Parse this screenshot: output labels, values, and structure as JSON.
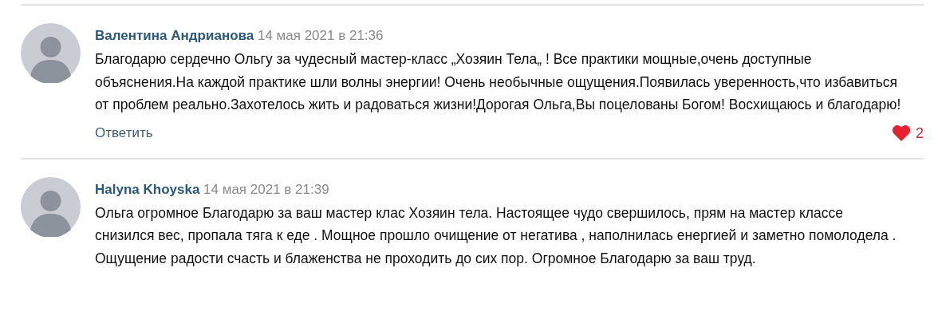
{
  "comments": [
    {
      "author": "Валентина Андрианова",
      "date": "14 мая 2021 в 21:36",
      "text": "Благодарю сердечно Ольгу за чудесный мастер-класс „Хозяин Тела„ ! Все практики мощные,очень доступные объяснения.На каждой практике шли волны энергии! Очень необычные ощущения.Появилась уверенность,что избавиться от проблем реально.Захотелось жить и радоваться жизни!Дорогая Ольга,Вы поцелованы Богом! Восхищаюсь и благодарю!",
      "reply": "Ответить",
      "likes": "2"
    },
    {
      "author": "Halyna Khoyska",
      "date": "14 мая 2021 в 21:39",
      "text": "Ольга огромное Благодарю за ваш мастер клас Хозяин тела. Настоящее чудо свершилось, прям на мастер классе снизился вес, пропала тяга к еде . Мощное прошло очищение от негатива , наполнилась енергией и заметно помолодела . Ощущение радости счасть и блаженства не проходить до сих пор. Огромное Благодарю за ваш труд."
    }
  ]
}
